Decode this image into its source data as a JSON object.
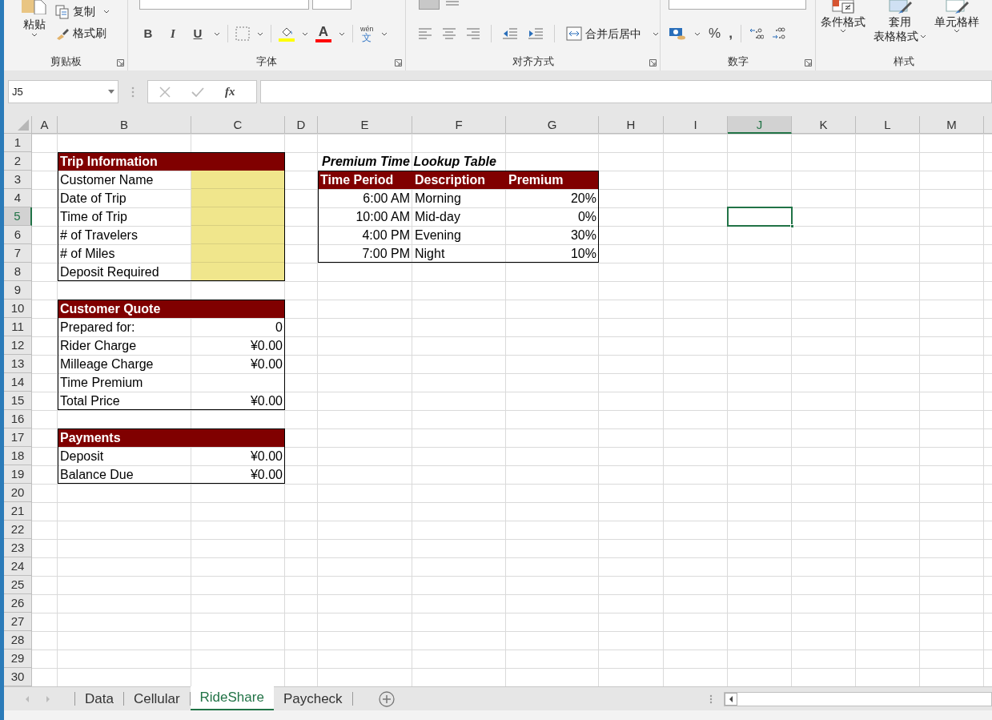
{
  "ribbon": {
    "clipboard": {
      "paste": "粘贴",
      "copy": "复制",
      "painter": "格式刷",
      "label": "剪贴板"
    },
    "font": {
      "bold": "B",
      "italic": "I",
      "underline": "U",
      "font_color": "A",
      "phonetic_top": "wén",
      "phonetic": "文",
      "label": "字体"
    },
    "alignment": {
      "merge": "合并后居中",
      "label": "对齐方式"
    },
    "number": {
      "percent": "%",
      "comma": ",",
      "label": "数字"
    },
    "styles": {
      "items": [
        {
          "lines": [
            "条件格式"
          ]
        },
        {
          "lines": [
            "套用",
            "表格格式"
          ]
        },
        {
          "lines": [
            "单元格样"
          ]
        }
      ],
      "label": "样式"
    }
  },
  "formula_bar": {
    "name_box": "J5",
    "fx": "fx"
  },
  "sheet": {
    "columns": [
      {
        "label": "A",
        "selected": false
      },
      {
        "label": "B",
        "selected": false
      },
      {
        "label": "C",
        "selected": false
      },
      {
        "label": "D",
        "selected": false
      },
      {
        "label": "E",
        "selected": false
      },
      {
        "label": "F",
        "selected": false
      },
      {
        "label": "G",
        "selected": false
      },
      {
        "label": "H",
        "selected": false
      },
      {
        "label": "I",
        "selected": false
      },
      {
        "label": "J",
        "selected": true
      },
      {
        "label": "K",
        "selected": false
      },
      {
        "label": "L",
        "selected": false
      },
      {
        "label": "M",
        "selected": false
      }
    ],
    "rows": [
      {
        "label": "1",
        "selected": false
      },
      {
        "label": "2",
        "selected": false
      },
      {
        "label": "3",
        "selected": false
      },
      {
        "label": "4",
        "selected": false
      },
      {
        "label": "5",
        "selected": true
      },
      {
        "label": "6",
        "selected": false
      },
      {
        "label": "7",
        "selected": false
      },
      {
        "label": "8",
        "selected": false
      },
      {
        "label": "9",
        "selected": false
      },
      {
        "label": "10",
        "selected": false
      },
      {
        "label": "11",
        "selected": false
      },
      {
        "label": "12",
        "selected": false
      },
      {
        "label": "13",
        "selected": false
      },
      {
        "label": "14",
        "selected": false
      },
      {
        "label": "15",
        "selected": false
      },
      {
        "label": "16",
        "selected": false
      },
      {
        "label": "17",
        "selected": false
      },
      {
        "label": "18",
        "selected": false
      },
      {
        "label": "19",
        "selected": false
      },
      {
        "label": "20",
        "selected": false
      },
      {
        "label": "21",
        "selected": false
      },
      {
        "label": "22",
        "selected": false
      },
      {
        "label": "23",
        "selected": false
      },
      {
        "label": "24",
        "selected": false
      },
      {
        "label": "25",
        "selected": false
      },
      {
        "label": "26",
        "selected": false
      },
      {
        "label": "27",
        "selected": false
      },
      {
        "label": "28",
        "selected": false
      },
      {
        "label": "29",
        "selected": false
      },
      {
        "label": "30",
        "selected": false
      }
    ],
    "forms": [
      {
        "title": "Trip Information",
        "rows": [
          {
            "label": "Customer Name",
            "kind": "input"
          },
          {
            "label": "Date of Trip",
            "kind": "input"
          },
          {
            "label": "Time of Trip",
            "kind": "input"
          },
          {
            "label": "# of Travelers",
            "kind": "input"
          },
          {
            "label": "# of Miles",
            "kind": "input"
          },
          {
            "label": "Deposit Required",
            "kind": "input"
          }
        ]
      },
      {
        "title": "Customer Quote",
        "rows": [
          {
            "label": "Prepared for:",
            "kind": "value",
            "value": "0"
          },
          {
            "label": "Rider Charge",
            "kind": "value",
            "value": "¥0.00"
          },
          {
            "label": "Milleage Charge",
            "kind": "value",
            "value": "¥0.00"
          },
          {
            "label": "Time Premium",
            "kind": "value"
          },
          {
            "label": "Total Price",
            "kind": "value",
            "value": "¥0.00"
          }
        ]
      },
      {
        "title": "Payments",
        "rows": [
          {
            "label": "Deposit",
            "kind": "value",
            "value": "¥0.00"
          },
          {
            "label": "Balance Due",
            "kind": "value",
            "value": "¥0.00"
          }
        ]
      }
    ],
    "lookup_table": {
      "title": "Premium Time Lookup Table",
      "columns": [
        "Time Period",
        "Description",
        "Premium"
      ],
      "rows": [
        [
          "6:00 AM",
          "Morning",
          "20%"
        ],
        [
          "10:00 AM",
          "Mid-day",
          "0%"
        ],
        [
          "4:00 PM",
          "Evening",
          "30%"
        ],
        [
          "7:00 PM",
          "Night",
          "10%"
        ]
      ]
    }
  },
  "sheet_tabs": [
    {
      "label": "Data",
      "selected": false
    },
    {
      "label": "Cellular",
      "selected": false
    },
    {
      "label": "RideShare",
      "selected": true
    },
    {
      "label": "Paycheck",
      "selected": false
    }
  ]
}
